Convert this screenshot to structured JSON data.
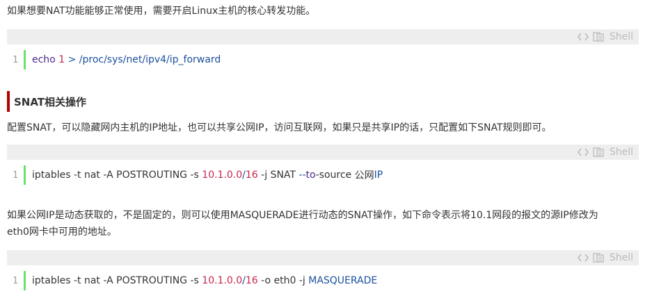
{
  "paragraphs": {
    "p1": "如果想要NAT功能能够正常使用，需要开启Linux主机的核心转发功能。",
    "p2": "配置SNAT，可以隐藏网内主机的IP地址，也可以共享公网IP，访问互联网，如果只是共享IP的话，只配置如下SNAT规则即可。",
    "p3_line1": "如果公网IP是动态获取的，不是固定的，则可以使用MASQUERADE进行动态的SNAT操作，如下命令表示将10.1网段的报文的源IP修改为",
    "p3_line2": "eth0网卡中可用的地址。"
  },
  "heading": {
    "text": "SNAT相关操作"
  },
  "code_blocks": [
    {
      "lang": "Shell",
      "line_number": "1",
      "tokens": [
        {
          "t": "echo",
          "c": "cmd"
        },
        {
          "t": " ",
          "c": "plain"
        },
        {
          "t": "1",
          "c": "num"
        },
        {
          "t": " ",
          "c": "plain"
        },
        {
          "t": ">",
          "c": "op"
        },
        {
          "t": " ",
          "c": "plain"
        },
        {
          "t": "/proc/sys/net/ipv4/ip_forward",
          "c": "str"
        }
      ]
    },
    {
      "lang": "Shell",
      "line_number": "1",
      "tokens": [
        {
          "t": "iptables -t nat -A POSTROUTING -s ",
          "c": "plain"
        },
        {
          "t": "10.1.0.0",
          "c": "num"
        },
        {
          "t": "/",
          "c": "op"
        },
        {
          "t": "16",
          "c": "num"
        },
        {
          "t": " -j SNAT ",
          "c": "plain"
        },
        {
          "t": "--",
          "c": "op"
        },
        {
          "t": "to",
          "c": "key"
        },
        {
          "t": "-source ",
          "c": "plain"
        },
        {
          "t": "公网",
          "c": "plain"
        },
        {
          "t": "IP",
          "c": "str"
        }
      ]
    },
    {
      "lang": "Shell",
      "line_number": "1",
      "tokens": [
        {
          "t": "iptables -t nat -A POSTROUTING -s ",
          "c": "plain"
        },
        {
          "t": "10.1.0.0",
          "c": "num"
        },
        {
          "t": "/",
          "c": "op"
        },
        {
          "t": "16",
          "c": "num"
        },
        {
          "t": " -o eth0 -j ",
          "c": "plain"
        },
        {
          "t": "MASQUERADE",
          "c": "str"
        }
      ]
    }
  ],
  "icons": {
    "view_source": "code-view-icon",
    "copy": "copy-icon"
  },
  "colors": {
    "heading_bar": "#b30000",
    "gutter_bar": "#6ce26c",
    "toolbar_bg": "#eeeeee"
  }
}
